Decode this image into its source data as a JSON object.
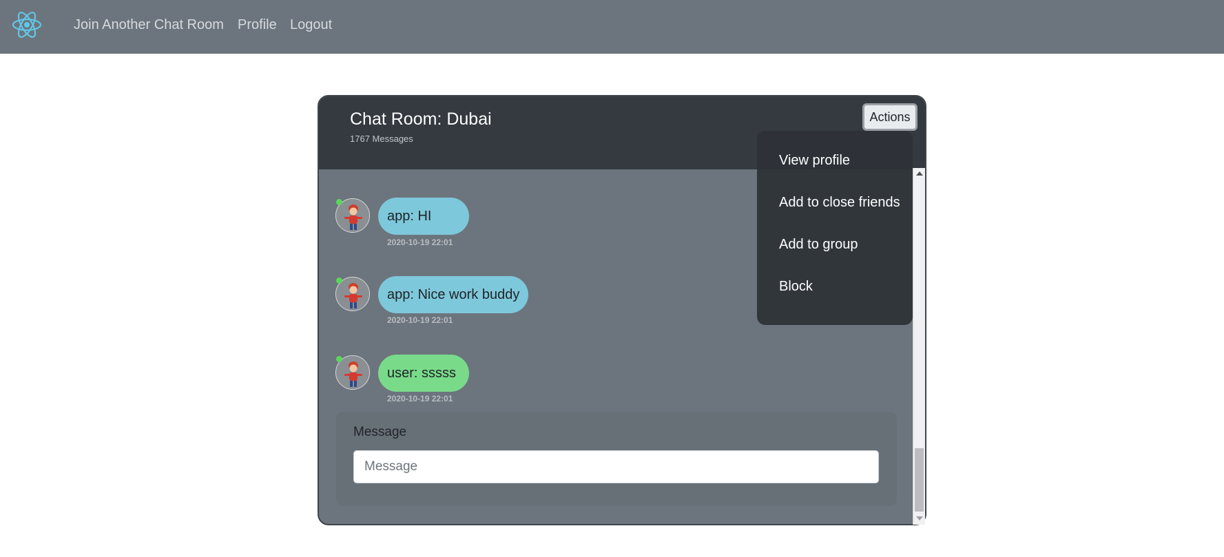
{
  "navbar": {
    "logo_icon": "react-atom-icon",
    "links": [
      {
        "label": "Join Another Chat Room"
      },
      {
        "label": "Profile"
      },
      {
        "label": "Logout"
      }
    ]
  },
  "chat": {
    "title": "Chat Room: Dubai",
    "message_count": "1767 Messages",
    "actions_label": "Actions",
    "messages": [
      {
        "sender": "app",
        "text": "app: HI",
        "timestamp": "2020-10-19 22:01",
        "bubble_color": "#7ec8db"
      },
      {
        "sender": "app",
        "text": "app: Nice work buddy",
        "timestamp": "2020-10-19 22:01",
        "bubble_color": "#7ec8db"
      },
      {
        "sender": "user",
        "text": "user: sssss",
        "timestamp": "2020-10-19 22:01",
        "bubble_color": "#79da8a"
      }
    ],
    "input": {
      "label": "Message",
      "placeholder": "Message",
      "value": ""
    }
  },
  "dropdown": {
    "items": [
      {
        "label": "View profile"
      },
      {
        "label": "Add to close friends"
      },
      {
        "label": "Add to group"
      },
      {
        "label": "Block"
      }
    ]
  },
  "colors": {
    "navbar": "#6c757d",
    "header": "#343a40",
    "online": "#5cd65c"
  }
}
